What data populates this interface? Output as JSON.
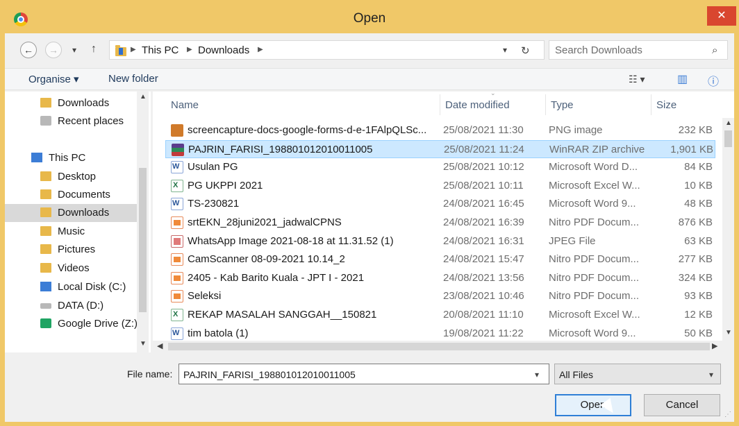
{
  "window": {
    "title": "Open",
    "close_glyph": "✕",
    "app_icon": "chrome-icon"
  },
  "nav": {
    "back_glyph": "←",
    "forward_glyph": "→",
    "up_glyph": "↑",
    "breadcrumb": [
      "This PC",
      "Downloads"
    ],
    "search_placeholder": "Search Downloads"
  },
  "command_bar": {
    "organise": "Organise ▾",
    "new_folder": "New folder"
  },
  "sidebar": {
    "items": [
      {
        "label": "Downloads",
        "icon": "folder-icon"
      },
      {
        "label": "Recent places",
        "icon": "recent-places-icon"
      },
      {
        "label": "This PC",
        "icon": "computer-icon"
      },
      {
        "label": "Desktop",
        "icon": "folder-icon"
      },
      {
        "label": "Documents",
        "icon": "folder-icon"
      },
      {
        "label": "Downloads",
        "icon": "folder-icon"
      },
      {
        "label": "Music",
        "icon": "folder-icon"
      },
      {
        "label": "Pictures",
        "icon": "folder-icon"
      },
      {
        "label": "Videos",
        "icon": "folder-icon"
      },
      {
        "label": "Local Disk (C:)",
        "icon": "drive-icon"
      },
      {
        "label": "DATA (D:)",
        "icon": "drive-icon"
      },
      {
        "label": "Google Drive (Z:)",
        "icon": "google-drive-icon"
      }
    ]
  },
  "columns": {
    "name": "Name",
    "date": "Date modified",
    "type": "Type",
    "size": "Size"
  },
  "files": [
    {
      "name": "screencapture-docs-google-forms-d-e-1FAlpQLSc...",
      "date": "25/08/2021 11:30",
      "type": "PNG image",
      "size": "232 KB",
      "icon": "png"
    },
    {
      "name": "PAJRIN_FARISI_198801012010011005",
      "date": "25/08/2021 11:24",
      "type": "WinRAR ZIP archive",
      "size": "1,901 KB",
      "icon": "zip"
    },
    {
      "name": "Usulan PG",
      "date": "25/08/2021 10:12",
      "type": "Microsoft Word D...",
      "size": "84 KB",
      "icon": "word"
    },
    {
      "name": "PG UKPPI 2021",
      "date": "25/08/2021 10:11",
      "type": "Microsoft Excel W...",
      "size": "10 KB",
      "icon": "excel"
    },
    {
      "name": "TS-230821",
      "date": "24/08/2021 16:45",
      "type": "Microsoft Word 9...",
      "size": "48 KB",
      "icon": "word"
    },
    {
      "name": "srtEKN_28juni2021_jadwalCPNS",
      "date": "24/08/2021 16:39",
      "type": "Nitro PDF Docum...",
      "size": "876 KB",
      "icon": "pdf"
    },
    {
      "name": "WhatsApp Image 2021-08-18 at 11.31.52 (1)",
      "date": "24/08/2021 16:31",
      "type": "JPEG File",
      "size": "63 KB",
      "icon": "jpg"
    },
    {
      "name": "CamScanner 08-09-2021 10.14_2",
      "date": "24/08/2021 15:47",
      "type": "Nitro PDF Docum...",
      "size": "277 KB",
      "icon": "pdf"
    },
    {
      "name": "2405 - Kab Barito Kuala - JPT I - 2021",
      "date": "24/08/2021 13:56",
      "type": "Nitro PDF Docum...",
      "size": "324 KB",
      "icon": "pdf"
    },
    {
      "name": "Seleksi",
      "date": "23/08/2021 10:46",
      "type": "Nitro PDF Docum...",
      "size": "93 KB",
      "icon": "pdf"
    },
    {
      "name": "REKAP MASALAH SANGGAH__150821",
      "date": "20/08/2021 11:10",
      "type": "Microsoft Excel W...",
      "size": "12 KB",
      "icon": "excel"
    },
    {
      "name": "tim batola (1)",
      "date": "19/08/2021 11:22",
      "type": "Microsoft Word 9...",
      "size": "50 KB",
      "icon": "word"
    }
  ],
  "selected_file_index": 1,
  "footer": {
    "file_name_label": "File name:",
    "file_name_value": "PAJRIN_FARISI_198801012010011005",
    "file_type_value": "All Files",
    "open_label": "Open",
    "cancel_label": "Cancel"
  }
}
